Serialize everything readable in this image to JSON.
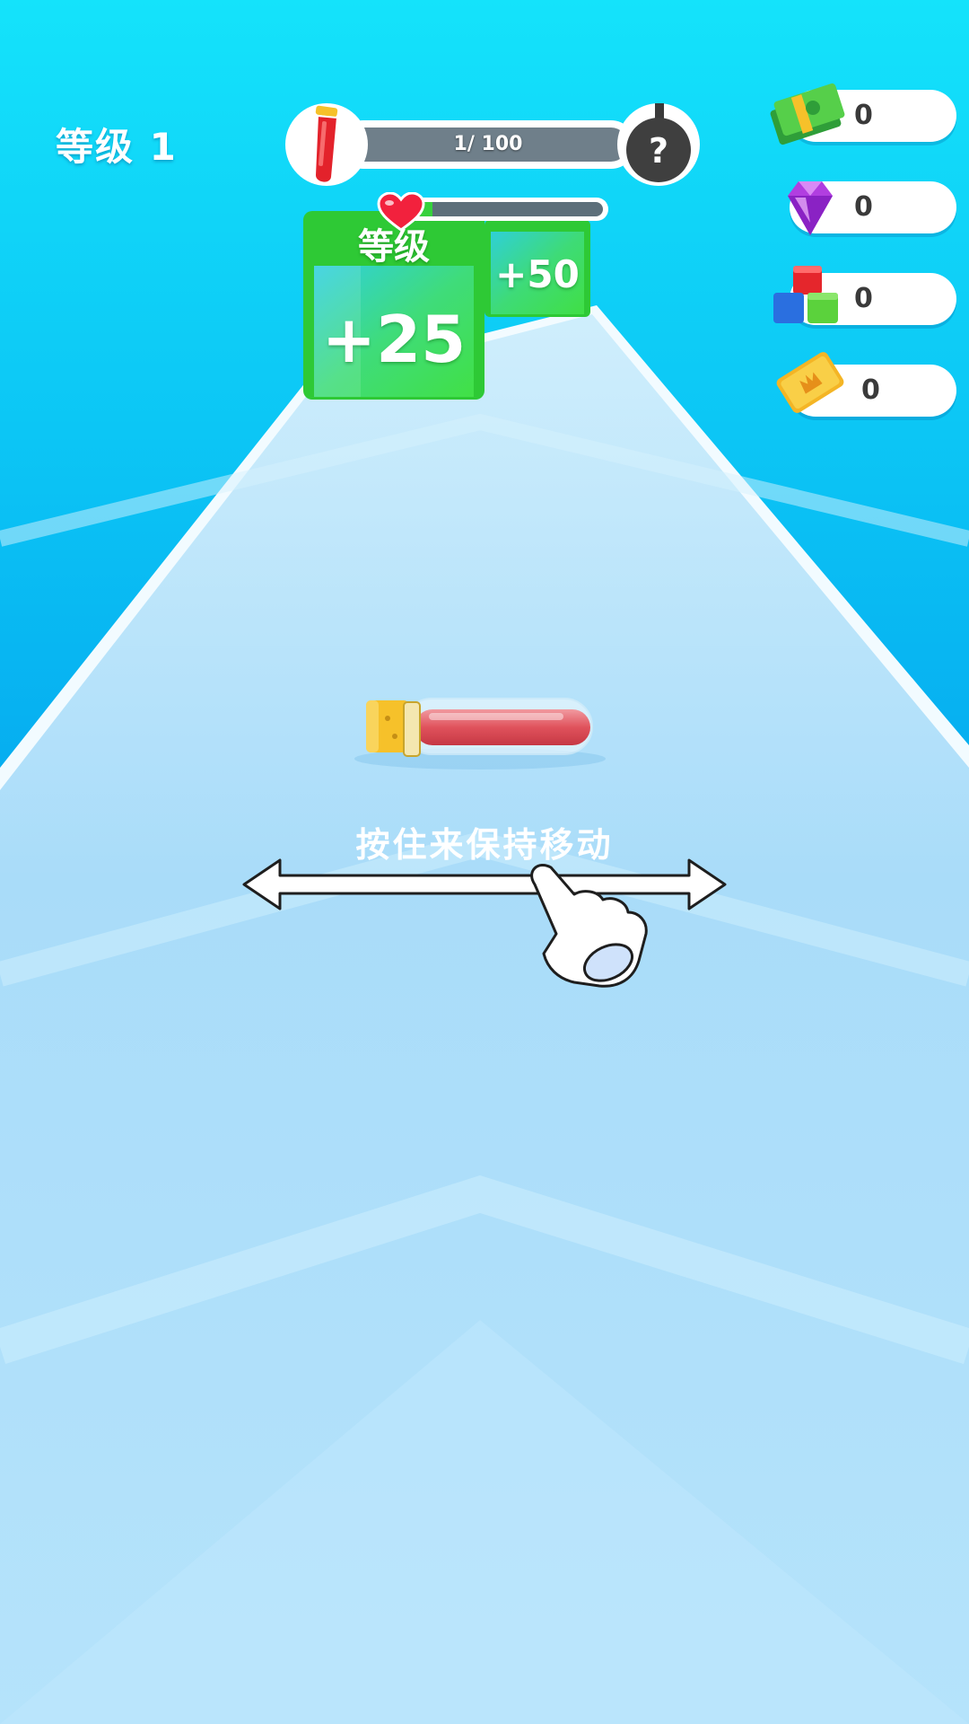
{
  "hud": {
    "level_label": "等级 1",
    "progress": {
      "text": "1/ 100",
      "current": 1,
      "max": 100
    },
    "health_fill": 0.12
  },
  "counters": [
    {
      "icon": "cash-icon",
      "value": "0"
    },
    {
      "icon": "gem-icon",
      "value": "0"
    },
    {
      "icon": "cubes-icon",
      "value": "0"
    },
    {
      "icon": "ticket-icon",
      "value": "0"
    }
  ],
  "gates": {
    "near": {
      "header": "等级",
      "value": "+25"
    },
    "far": {
      "value": "+50"
    }
  },
  "tutorial": {
    "hint": "按住来保持移动"
  },
  "colors": {
    "sky_top": "#14e3fb",
    "track": "#bfe6fb",
    "gate_green": "#3fd93e",
    "health_green": "#36d13c",
    "tube_red": "#e04e5a",
    "cork_yellow": "#f6c12a"
  }
}
